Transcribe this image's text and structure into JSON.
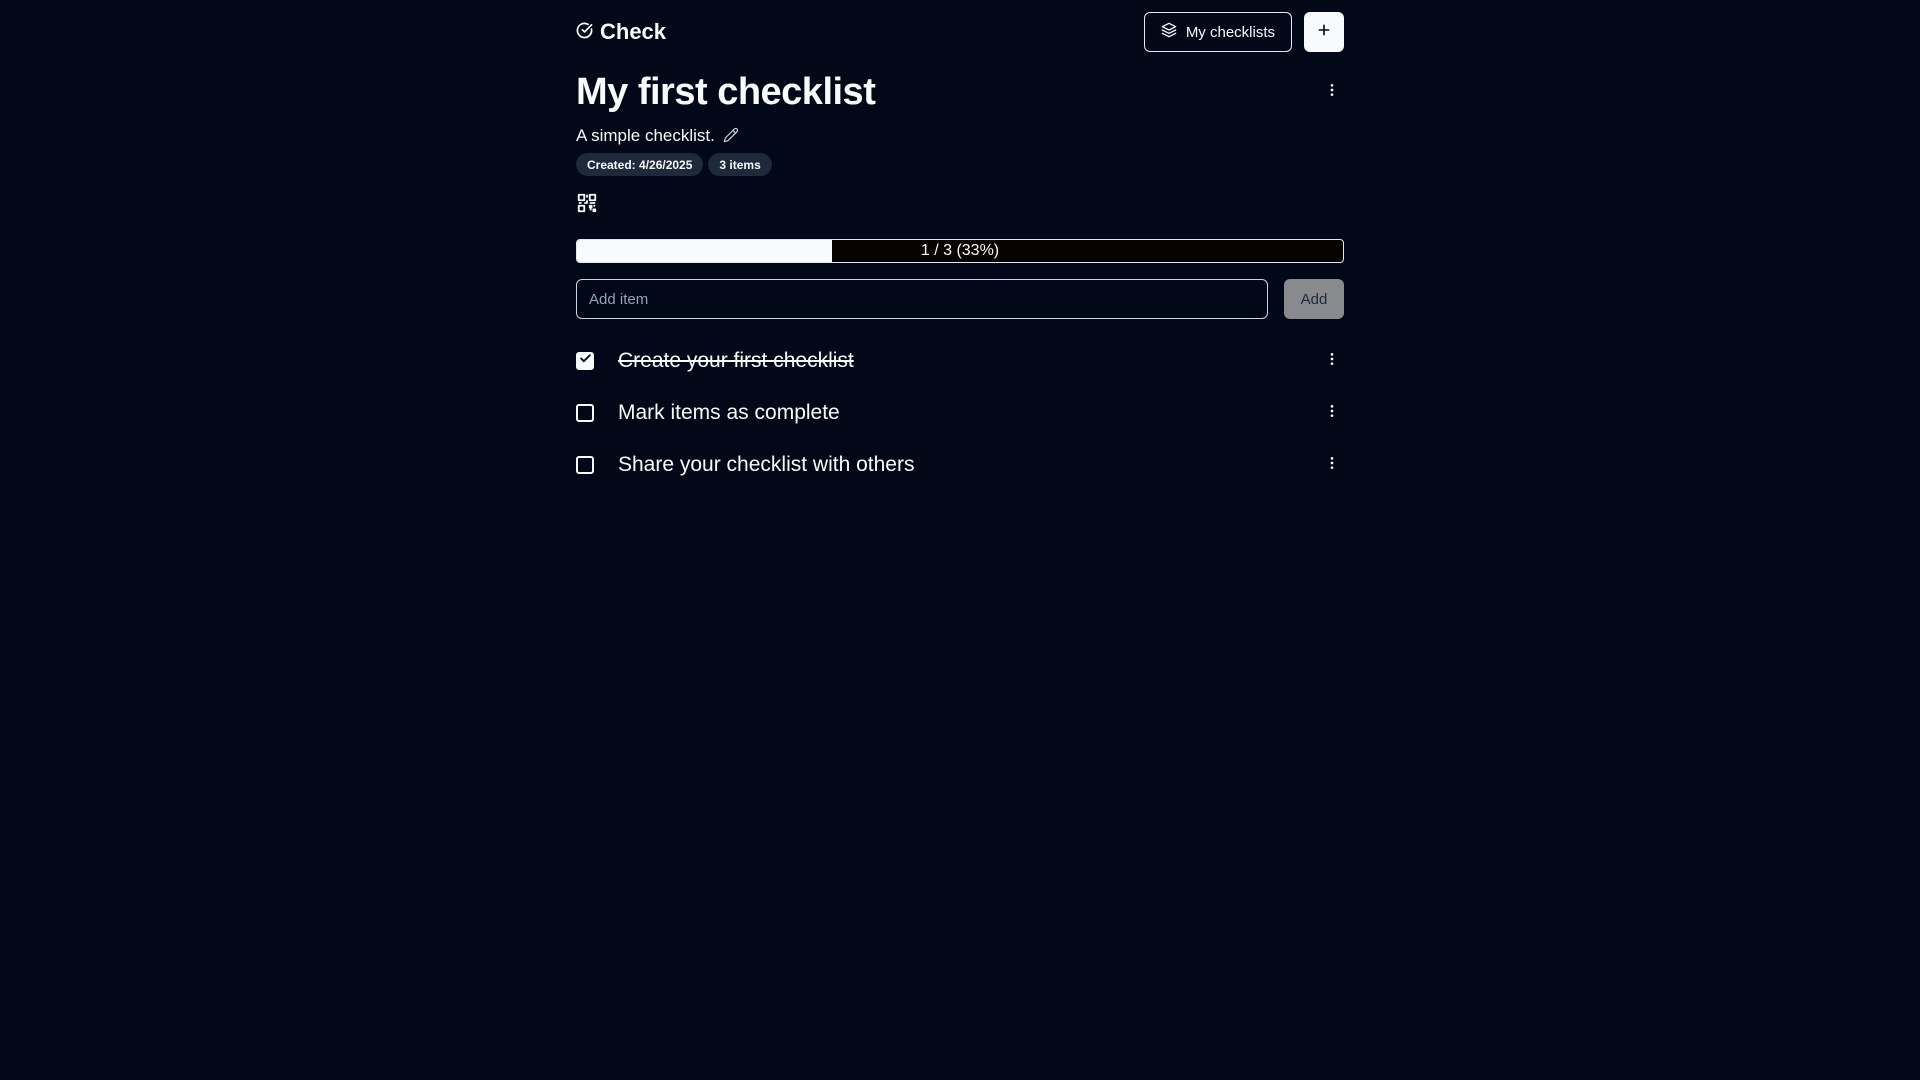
{
  "app": {
    "name": "Check",
    "my_checklists_label": "My checklists"
  },
  "checklist": {
    "title": "My first checklist",
    "description": "A simple checklist.",
    "created_badge": "Created: 4/26/2025",
    "count_badge": "3 items"
  },
  "progress": {
    "completed": 1,
    "total": 3,
    "fraction": 0.33,
    "label": "1 / 3 (33%)"
  },
  "add_item": {
    "placeholder": "Add item",
    "button_label": "Add"
  },
  "items": [
    {
      "text": "Create your first checklist",
      "checked": true
    },
    {
      "text": "Mark items as complete",
      "checked": false
    },
    {
      "text": "Share your checklist with others",
      "checked": false
    }
  ],
  "colors": {
    "background": "#020817",
    "foreground": "#f8fafc",
    "badge_bg": "#1e293b",
    "add_button_bg": "#888a8e"
  },
  "icons": {
    "logo": "circle-check-icon",
    "my_checklists": "layers-icon",
    "new": "plus-icon",
    "menu": "more-vertical-icon",
    "edit": "pencil-icon",
    "share": "qr-code-icon",
    "checked": "check-icon"
  }
}
